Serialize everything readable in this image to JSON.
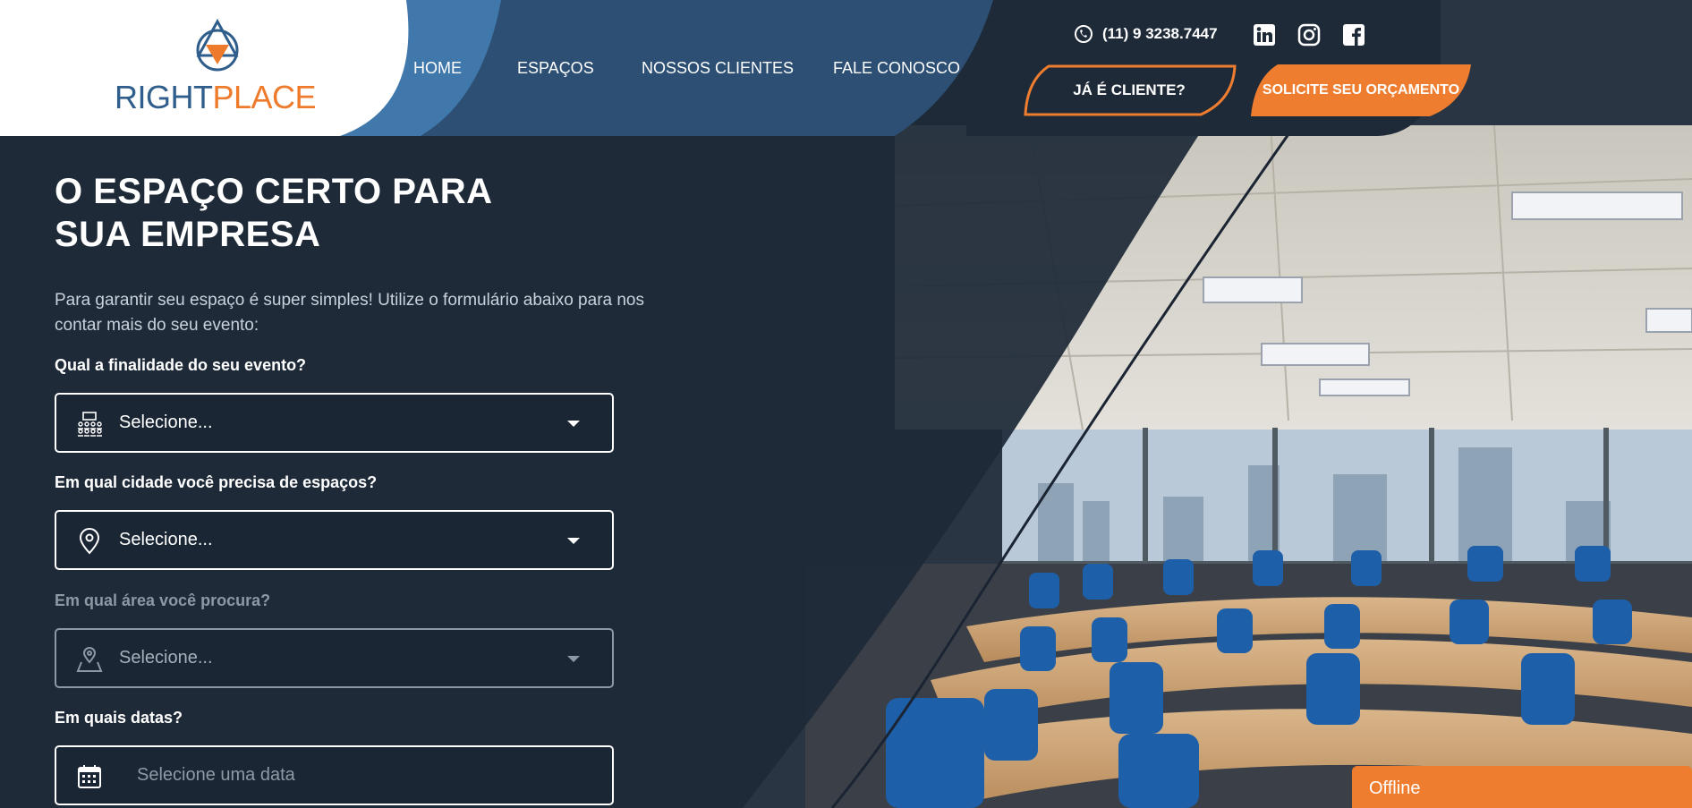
{
  "brand": {
    "name_part1": "RIGHT",
    "name_part2": "PLACE"
  },
  "nav": {
    "items": [
      {
        "label": "HOME"
      },
      {
        "label": "ESPAÇOS"
      },
      {
        "label": "NOSSOS CLIENTES"
      },
      {
        "label": "FALE CONOSCO"
      }
    ]
  },
  "contact": {
    "phone": "(11) 9 3238.7447",
    "social": [
      "linkedin-icon",
      "instagram-icon",
      "facebook-icon"
    ]
  },
  "cta": {
    "client_label": "JÁ É CLIENTE?",
    "quote_label": "SOLICITE SEU ORÇAMENTO"
  },
  "hero": {
    "headline_line1": "O ESPAÇO CERTO PARA",
    "headline_line2": "SUA EMPRESA",
    "intro": "Para garantir seu espaço é super simples! Utilize o formulário abaixo para nos contar mais do seu evento:"
  },
  "form": {
    "purpose_label": "Qual a finalidade do seu evento?",
    "purpose_value": "Selecione...",
    "city_label": "Em qual cidade você precisa de espaços?",
    "city_value": "Selecione...",
    "area_label": "Em qual área você procura?",
    "area_value": "Selecione...",
    "dates_label": "Em quais datas?",
    "dates_placeholder": "Selecione uma data"
  },
  "chat": {
    "status": "Offline"
  },
  "colors": {
    "navy": "#1e2a38",
    "blue": "#2f5d8c",
    "orange": "#ef7d2f"
  }
}
